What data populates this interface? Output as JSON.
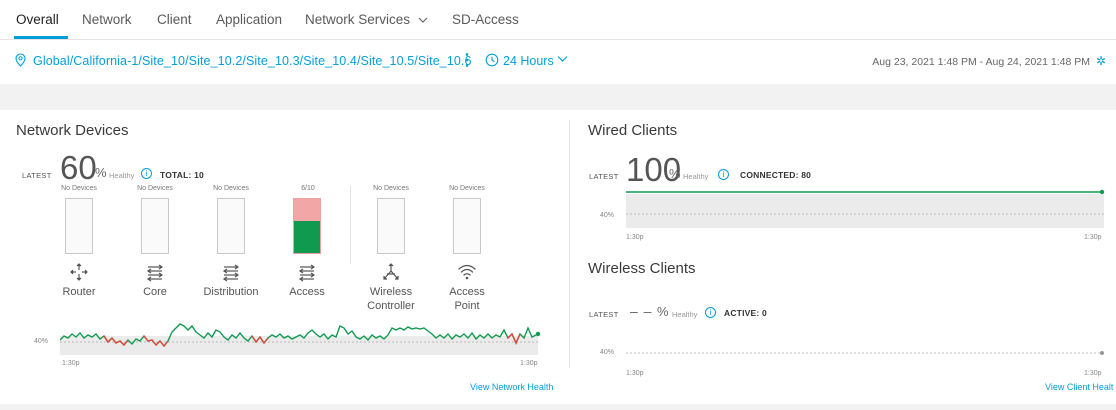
{
  "tabs": [
    {
      "label": "Overall"
    },
    {
      "label": "Network"
    },
    {
      "label": "Client"
    },
    {
      "label": "Application"
    },
    {
      "label": "Network Services"
    },
    {
      "label": "SD-Access"
    }
  ],
  "location": {
    "path": "Global/California-1/Site_10/Site_10.2/Site_10.3/Site_10.4/Site_10.5/Site_10.6",
    "time_range": "24 Hours",
    "date_range": "Aug 23, 2021 1:48 PM - Aug 24, 2021 1:48 PM"
  },
  "network_devices": {
    "title": "Network Devices",
    "latest_label": "LATEST",
    "percent": "60",
    "pct_symbol": "%",
    "healthy_label": "Healthy",
    "info_glyph": "i",
    "total": "TOTAL: 10",
    "devices": [
      {
        "status": "No Devices",
        "label": "Router",
        "icon": "router-icon"
      },
      {
        "status": "No Devices",
        "label": "Core",
        "icon": "switch-icon"
      },
      {
        "status": "No Devices",
        "label": "Distribution",
        "icon": "switch-icon"
      },
      {
        "status": "6/10",
        "label": "Access",
        "icon": "switch-icon",
        "healthy_fraction": 0.6
      },
      {
        "status": "No Devices",
        "label_line1": "Wireless",
        "label_line2": "Controller",
        "icon": "wireless-controller-icon"
      },
      {
        "status": "No Devices",
        "label_line1": "Access",
        "label_line2": "Point",
        "icon": "wifi-icon"
      }
    ],
    "chart": {
      "threshold_label": "40%",
      "x_start": "1:30p",
      "x_end": "1:30p"
    },
    "link": "View Network Health"
  },
  "wired_clients": {
    "title": "Wired Clients",
    "latest_label": "LATEST",
    "percent": "100",
    "pct_symbol": "%",
    "healthy_label": "Healthy",
    "info_glyph": "i",
    "summary": "CONNECTED: 80",
    "chart": {
      "threshold_label": "40%",
      "x_start": "1:30p",
      "x_end": "1:30p"
    }
  },
  "wireless_clients": {
    "title": "Wireless Clients",
    "latest_label": "LATEST",
    "percent": "– –",
    "pct_symbol": "%",
    "healthy_label": "Healthy",
    "info_glyph": "i",
    "summary": "ACTIVE: 0",
    "chart": {
      "threshold_label": "40%",
      "x_start": "1:30p",
      "x_end": "1:30p"
    },
    "link": "View Client Healt"
  },
  "colors": {
    "accent": "#049fd9",
    "healthy": "#0f9a4f",
    "unhealthy": "#e0453a"
  }
}
